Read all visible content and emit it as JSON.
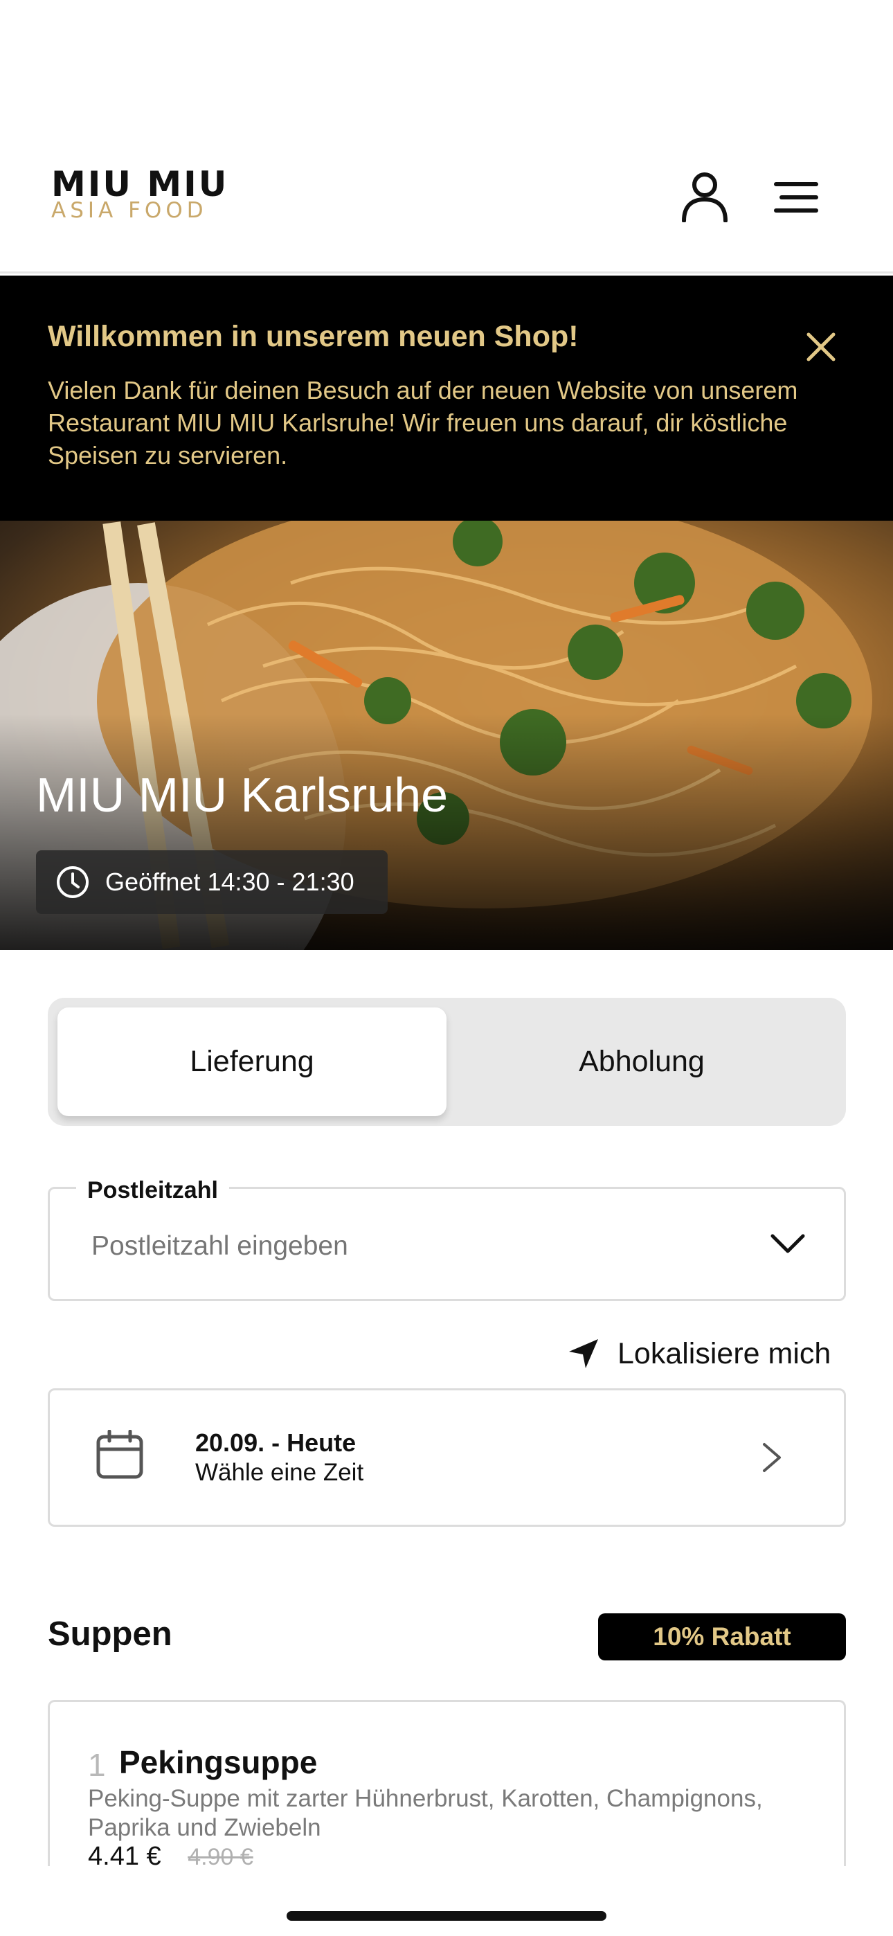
{
  "header": {
    "logo_main": "MIU MIU",
    "logo_sub": "ASIA FOOD",
    "profile_icon": "user-icon",
    "menu_icon": "hamburger-menu-icon"
  },
  "banner": {
    "title": "Willkommen in unserem neuen Shop!",
    "text": "Vielen Dank für deinen Besuch auf der neuen Website von unserem Restaurant MIU MIU Karlsruhe! Wir freuen uns darauf, dir köstliche Speisen zu servieren.",
    "close_icon": "close-icon",
    "background": "#000000",
    "accent": "#e2c887"
  },
  "hero": {
    "title": "MIU MIU Karlsruhe",
    "hours_icon": "clock-icon",
    "hours": "Geöffnet 14:30 - 21:30"
  },
  "order_mode": {
    "tabs": [
      {
        "label": "Lieferung",
        "active": true
      },
      {
        "label": "Abholung",
        "active": false
      }
    ]
  },
  "postal_code": {
    "label": "Postleitzahl",
    "placeholder": "Postleitzahl eingeben",
    "value": "",
    "icon": "chevron-down-icon"
  },
  "locate": {
    "label": "Lokalisiere mich",
    "icon": "location-arrow-icon"
  },
  "date_picker": {
    "date": "20.09. - Heute",
    "hint": "Wähle eine Zeit",
    "icon": "calendar-icon",
    "chevron": "chevron-right-icon"
  },
  "section": {
    "title": "Suppen",
    "badge": "10% Rabatt"
  },
  "products": [
    {
      "number": "1",
      "name": "Pekingsuppe",
      "description": "Peking-Suppe mit zarter Hühnerbrust, Karotten, Champignons, Paprika und Zwiebeln",
      "price": "4.41 €",
      "old_price": "4.90 €"
    }
  ]
}
